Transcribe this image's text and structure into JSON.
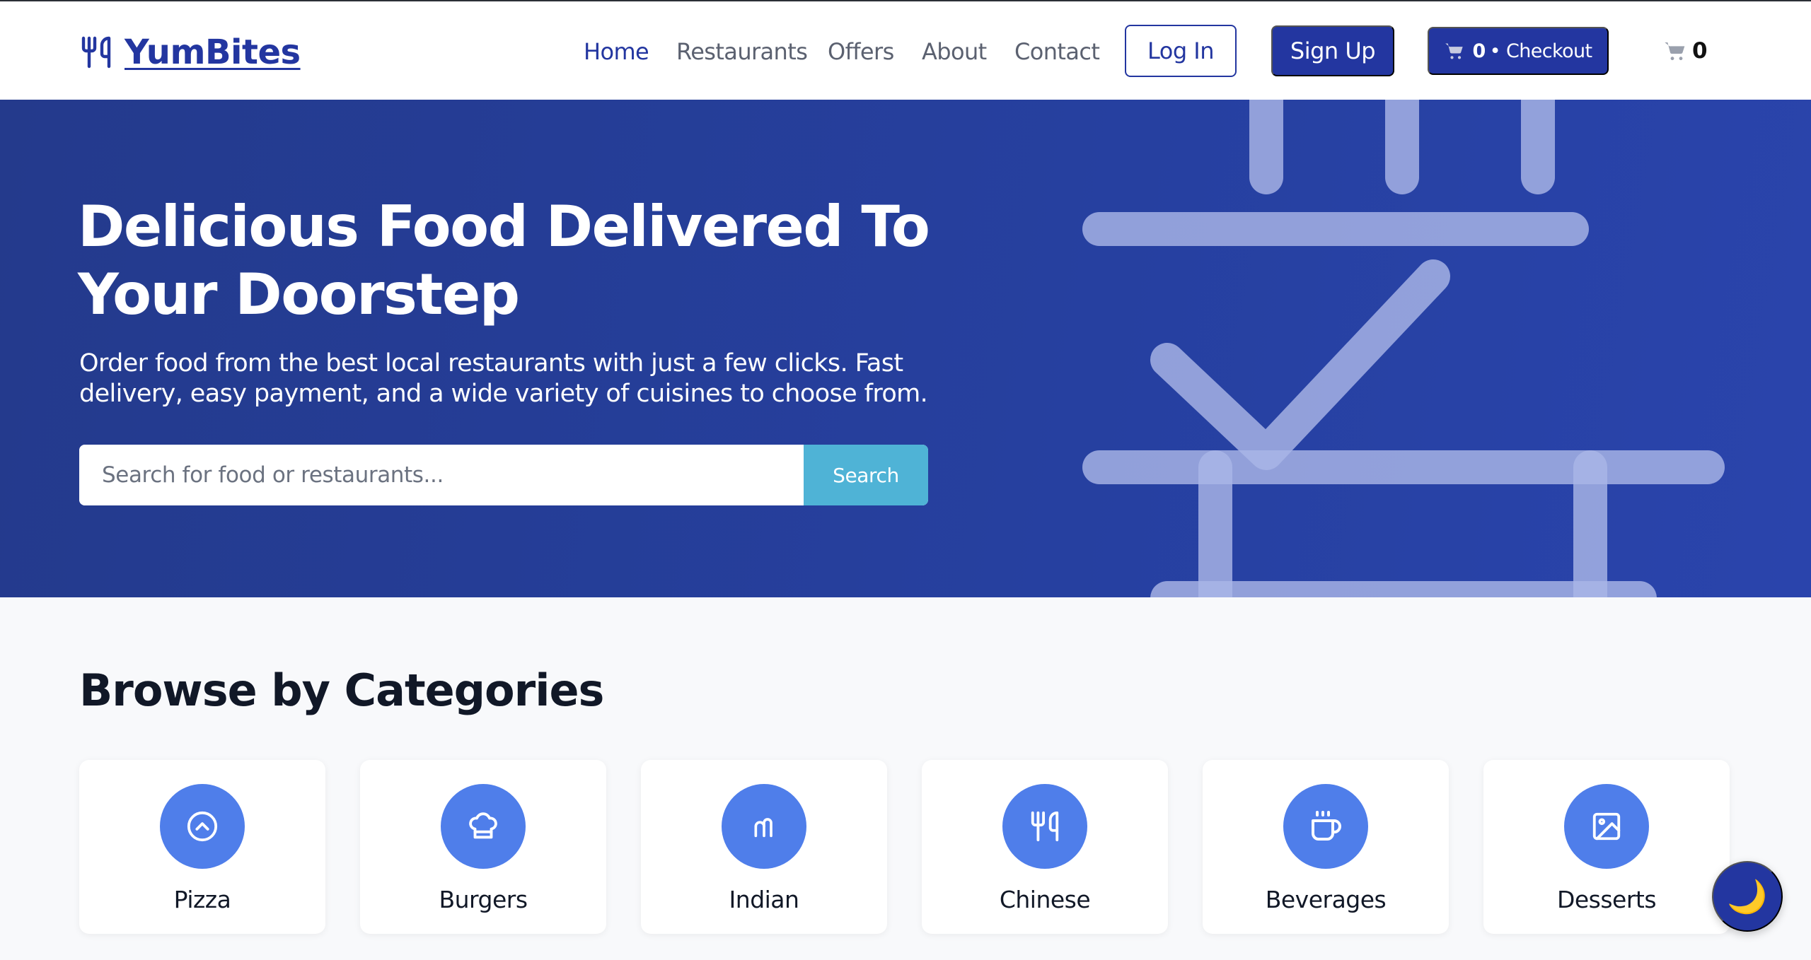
{
  "brand": {
    "name": "YumBites"
  },
  "nav": {
    "items": [
      {
        "label": "Home",
        "active": true
      },
      {
        "label": "Restaurants",
        "active": false
      },
      {
        "label": "Offers",
        "active": false
      },
      {
        "label": "About",
        "active": false
      },
      {
        "label": "Contact",
        "active": false
      }
    ],
    "login_label": "Log In",
    "signup_label": "Sign Up",
    "checkout": {
      "count": "0",
      "label": "• Checkout"
    },
    "cart_count": "0"
  },
  "hero": {
    "title": "Delicious Food Delivered To Your Doorstep",
    "subtitle": "Order food from the best local restaurants with just a few clicks. Fast delivery, easy payment, and a wide variety of cuisines to choose from.",
    "search_placeholder": "Search for food or restaurants...",
    "search_button": "Search"
  },
  "categories": {
    "title": "Browse by Categories",
    "items": [
      {
        "label": "Pizza",
        "icon": "chevron-up-circle-icon"
      },
      {
        "label": "Burgers",
        "icon": "chef-hat-icon"
      },
      {
        "label": "Indian",
        "icon": "chart-bars-icon"
      },
      {
        "label": "Chinese",
        "icon": "utensils-icon"
      },
      {
        "label": "Beverages",
        "icon": "coffee-cup-icon"
      },
      {
        "label": "Desserts",
        "icon": "image-icon"
      }
    ]
  },
  "theme_toggle": {
    "icon": "moon-icon",
    "symbol": "🌙"
  },
  "colors": {
    "brand": "#2336a0",
    "hero_bg": "#2640a0",
    "search_button": "#4fb3d6",
    "category_circle": "#4f7eea",
    "page_bg": "#f8f9fb"
  }
}
